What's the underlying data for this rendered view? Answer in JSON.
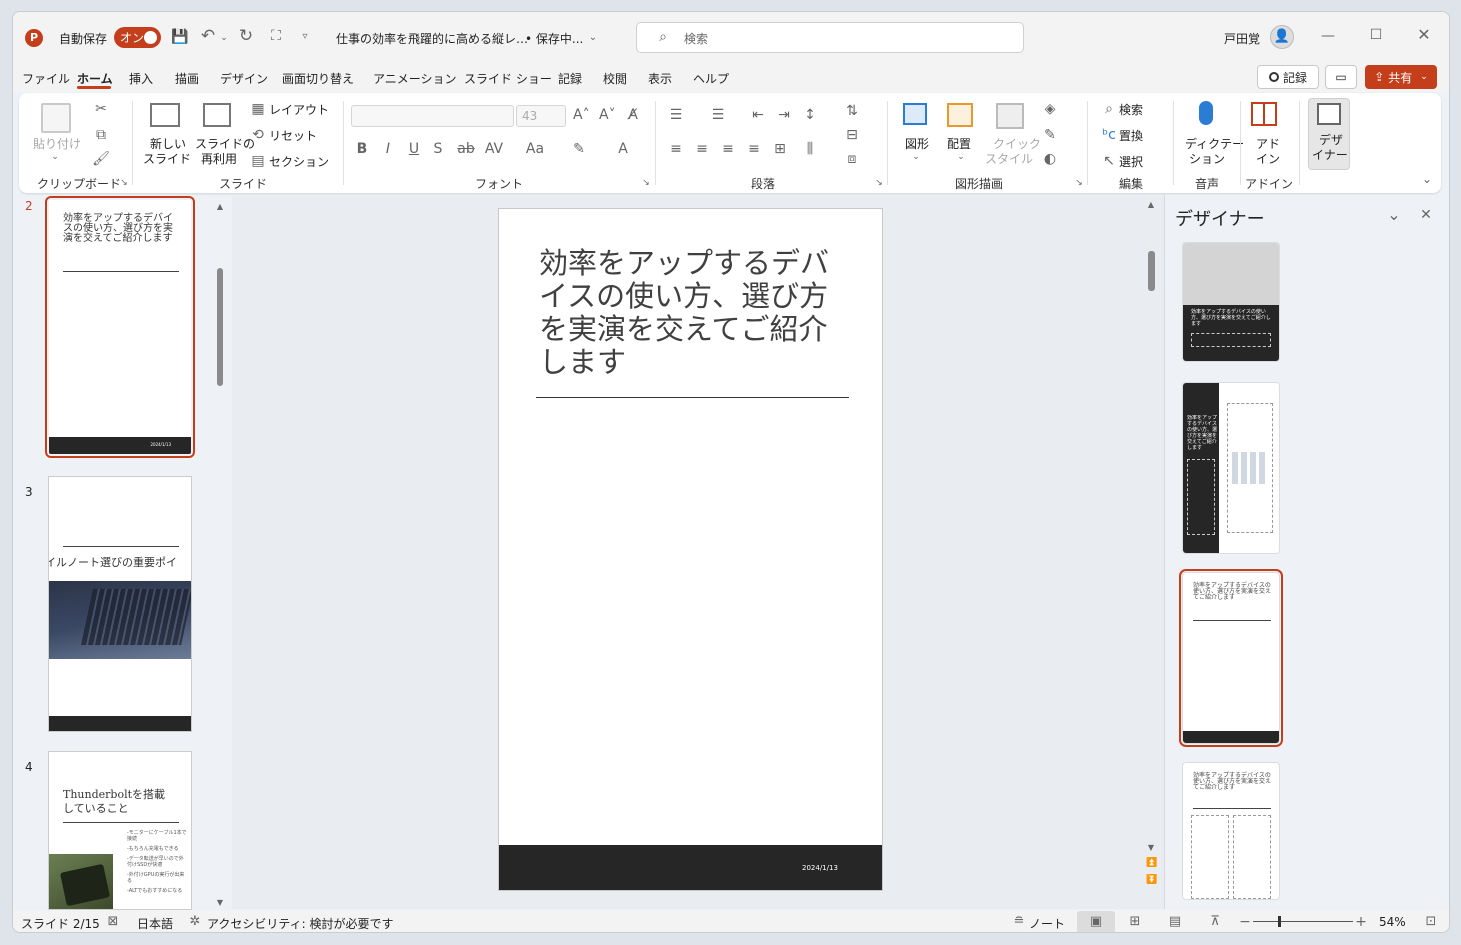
{
  "app": {
    "autosave_label": "自動保存",
    "autosave_state": "オン",
    "doc_title": "仕事の効率を飛躍的に高める縦レ…",
    "save_state": "• 保存中...",
    "search_placeholder": "検索",
    "user_name": "戸田覚"
  },
  "menu": [
    "ファイル",
    "ホーム",
    "挿入",
    "描画",
    "デザイン",
    "画面切り替え",
    "アニメーション",
    "スライド ショー",
    "記録",
    "校閲",
    "表示",
    "ヘルプ"
  ],
  "menu_right": {
    "record": "記録",
    "share": "共有"
  },
  "ribbon": {
    "clipboard": {
      "paste": "貼り付け",
      "label": "クリップボード"
    },
    "slides": {
      "new_slide_1": "新しい",
      "new_slide_2": "スライド",
      "reuse_1": "スライドの",
      "reuse_2": "再利用",
      "layout": "レイアウト",
      "reset": "リセット",
      "section": "セクション",
      "label": "スライド"
    },
    "font": {
      "size": "43",
      "label": "フォント"
    },
    "paragraph": {
      "label": "段落"
    },
    "drawing": {
      "shapes": "図形",
      "arrange": "配置",
      "quick_1": "クイック",
      "quick_2": "スタイル",
      "label": "図形描画"
    },
    "editing": {
      "find": "検索",
      "replace": "置換",
      "select": "選択",
      "label": "編集"
    },
    "voice": {
      "dictate_1": "ディクテー",
      "dictate_2": "ション",
      "label": "音声"
    },
    "addin": {
      "addin_1": "アド",
      "addin_2": "イン",
      "label": "アドイン"
    },
    "designer": {
      "d1": "デザ",
      "d2": "イナー"
    }
  },
  "thumbnails": [
    {
      "num": "2",
      "title": "効率をアップするデバイスの使い方、選び方を実演を交えてご紹介します",
      "footer": "2024/1/13"
    },
    {
      "num": "3",
      "title": "イルノート選びの重要ポイ"
    },
    {
      "num": "4",
      "title": "Thunderboltを搭載していること",
      "bullets": [
        "-モニターにケーブル1本で接続",
        "-もちろん充電もできる",
        "-データ転送が早いので外付けSSDが快適",
        "-外付けGPUの実行が出来る",
        "-ALTでもおすすめになる"
      ]
    }
  ],
  "slide": {
    "title": "効率をアップするデバイスの使い方、選び方を実演を交えてご紹介します",
    "date": "2024/1/13"
  },
  "designer_panel": {
    "title": "デザイナー",
    "t1": "効率をアップするデバイスの使い方、選び方を実演を交えてご紹介します",
    "t2": "効率をアップするデバイスの使い方、選び方を実演を交えてご紹介します",
    "t3": "効率をアップするデバイスの使い方、選び方を実演を交えてご紹介します",
    "t4": "効率をアップするデバイスの使い方、選び方を実演を交えてご紹介します"
  },
  "status": {
    "slide": "スライド 2/15",
    "lang": "日本語",
    "access": "アクセシビリティ: 検討が必要です",
    "notes": "ノート",
    "zoom": "54%"
  },
  "colors": {
    "accent": "#c43e1c",
    "dark_band": "#262626"
  }
}
